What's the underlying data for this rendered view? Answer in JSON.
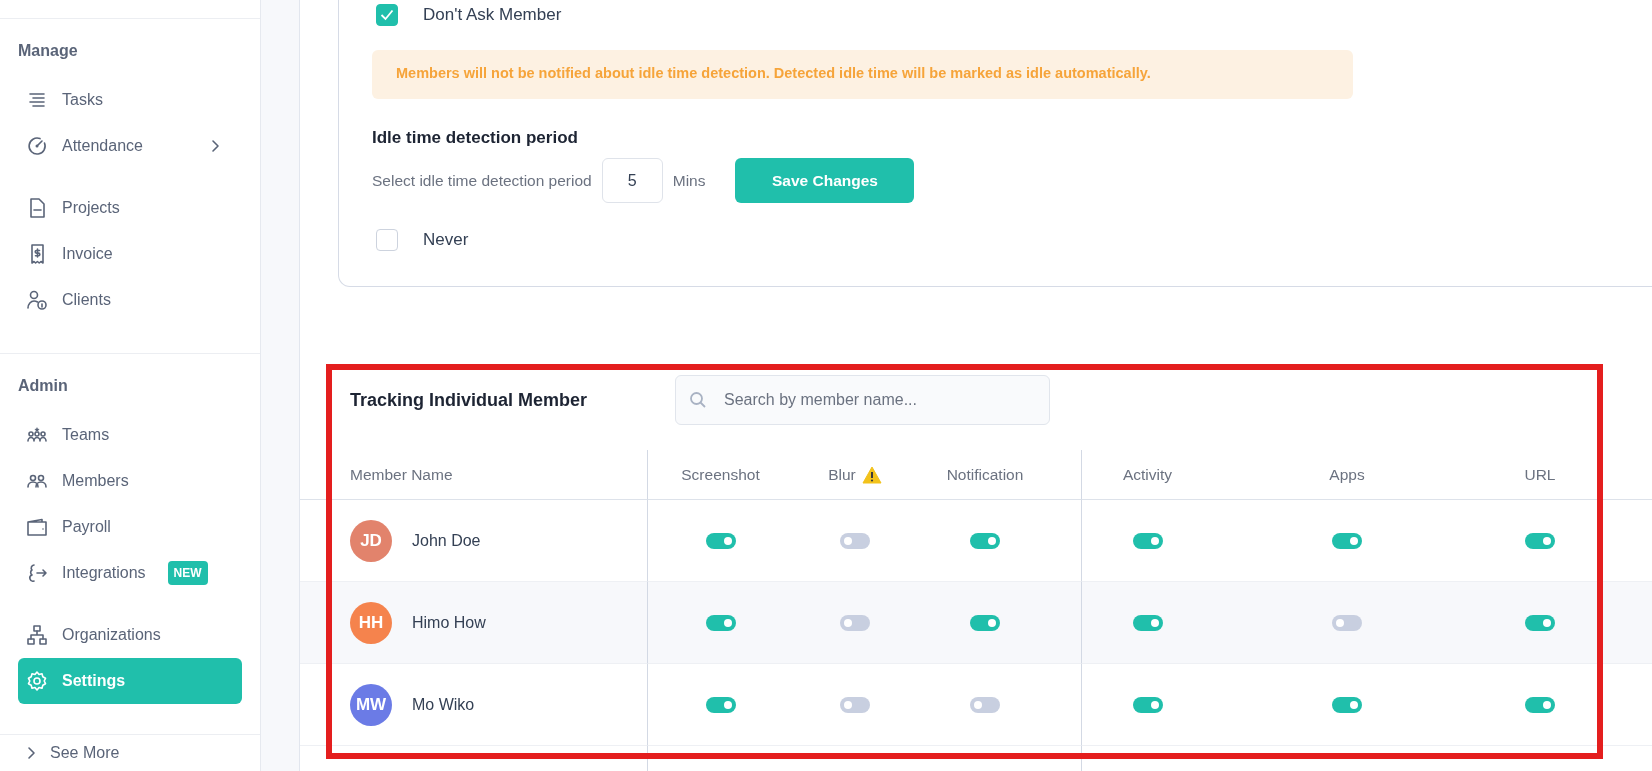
{
  "sidebar": {
    "sections": [
      {
        "title": "Manage",
        "groups": [
          [
            {
              "label": "Tasks",
              "selected": false,
              "expandable": false
            },
            {
              "label": "Attendance",
              "selected": false,
              "expandable": true
            }
          ],
          [
            {
              "label": "Projects",
              "selected": false,
              "expandable": false
            },
            {
              "label": "Invoice",
              "selected": false,
              "expandable": false
            },
            {
              "label": "Clients",
              "selected": false,
              "expandable": false
            }
          ]
        ]
      },
      {
        "title": "Admin",
        "groups": [
          [
            {
              "label": "Teams",
              "selected": false,
              "expandable": false
            },
            {
              "label": "Members",
              "selected": false,
              "expandable": false
            },
            {
              "label": "Payroll",
              "selected": false,
              "expandable": false
            },
            {
              "label": "Integrations",
              "selected": false,
              "expandable": false,
              "badge": "NEW"
            }
          ],
          [
            {
              "label": "Organizations",
              "selected": false,
              "expandable": false
            },
            {
              "label": "Settings",
              "selected": true,
              "expandable": false
            }
          ]
        ]
      }
    ],
    "see_more": "See More"
  },
  "idle_settings": {
    "dont_ask": {
      "label": "Don't Ask Member",
      "checked": true
    },
    "notice": "Members will not be notified about idle time detection. Detected idle time will be marked as idle automatically.",
    "period": {
      "heading": "Idle time detection period",
      "label": "Select idle time detection period",
      "value": "5",
      "unit": "Mins",
      "button": "Save Changes"
    },
    "never": {
      "label": "Never",
      "checked": false
    }
  },
  "tracking": {
    "title": "Tracking Individual Member",
    "search": {
      "placeholder": "Search by member name..."
    },
    "columns": [
      "Member Name",
      "Screenshot",
      "Blur",
      "Notification",
      "Activity",
      "Apps",
      "URL"
    ],
    "rows": [
      {
        "initials": "JD",
        "name": "John Doe",
        "color": "#e2836c",
        "toggles": [
          true,
          false,
          true,
          true,
          true,
          true
        ]
      },
      {
        "initials": "HH",
        "name": "Himo How",
        "color": "#f5834d",
        "toggles": [
          true,
          false,
          true,
          true,
          false,
          true
        ]
      },
      {
        "initials": "MW",
        "name": "Mo Wiko",
        "color": "#6b7be6",
        "toggles": [
          true,
          false,
          false,
          true,
          true,
          true
        ]
      }
    ]
  }
}
